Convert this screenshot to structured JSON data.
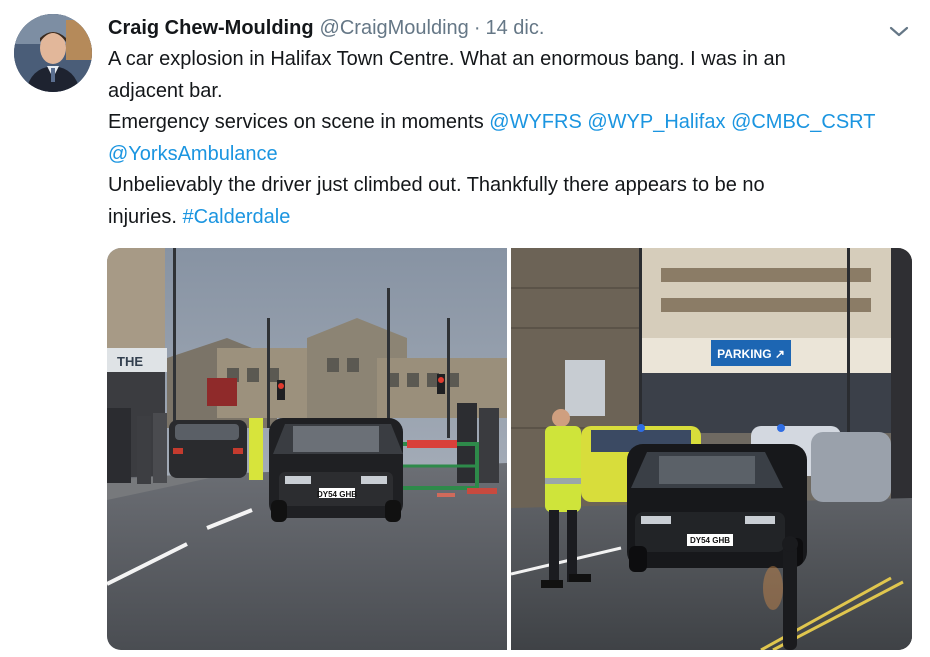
{
  "tweet": {
    "display_name": "Craig Chew-Moulding",
    "handle": "@CraigMoulding",
    "separator": "·",
    "date": "14 dic.",
    "text": {
      "line1": "A car explosion in Halifax Town Centre. What an enormous bang. I was in an",
      "line2": "adjacent bar.",
      "line3_prefix": "Emergency services on scene in moments ",
      "mentions": [
        "@WYFRS",
        "@WYP_Halifax",
        "@CMBC_CSRT",
        "@YorksAmbulance"
      ],
      "line5": "Unbelievably the driver just climbed out. Thankfully there appears to be no",
      "line6_prefix": "injuries. ",
      "hashtag": "#Calderdale"
    }
  },
  "photos": {
    "left": {
      "bar_sign": "THE",
      "plate": "DY54 GHB"
    },
    "right": {
      "parking_sign": "PARKING ↗",
      "plate": "DY54 GHB"
    }
  },
  "icons": {
    "caret": "chevron-down-icon",
    "avatar": "avatar"
  },
  "colors": {
    "text": "#14171a",
    "secondary": "#657786",
    "link": "#1b95e0"
  }
}
